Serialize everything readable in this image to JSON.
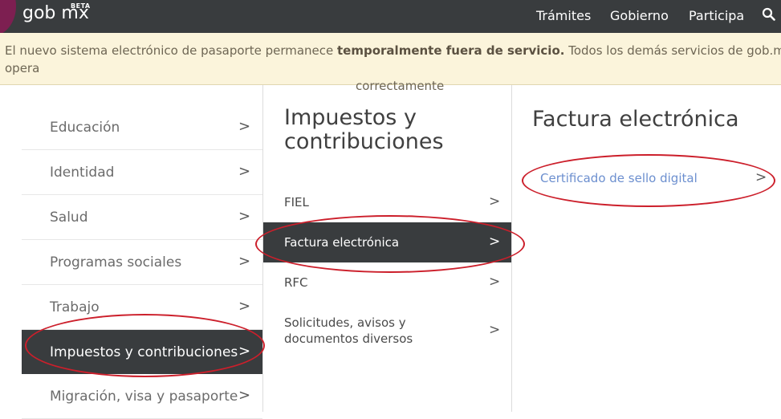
{
  "header": {
    "logo": "gob mx",
    "beta": "BETA",
    "nav": [
      "Trámites",
      "Gobierno",
      "Participa"
    ],
    "search_icon": "search-icon"
  },
  "banner": {
    "text_before": "El nuevo sistema electrónico de pasaporte permanece ",
    "text_bold": "temporalmente fuera de servicio.",
    "text_after": " Todos los demás servicios de gob.mx opera",
    "text_line2": "correctamente"
  },
  "column1": {
    "items": [
      "Educación",
      "Identidad",
      "Salud",
      "Programas sociales",
      "Trabajo",
      "Impuestos y contribuciones",
      "Migración, visa y pasaporte"
    ],
    "active_index": 5,
    "chevron": ">"
  },
  "column2": {
    "title": "Impuestos y contribuciones",
    "items": [
      "FIEL",
      "Factura electrónica",
      "RFC",
      "Solicitudes, avisos y documentos diversos"
    ],
    "active_index": 1,
    "chevron": ">"
  },
  "column3": {
    "title": "Factura electrónica",
    "items": [
      "Certificado de sello digital"
    ],
    "chevron": ">"
  },
  "colors": {
    "header_bg": "#393c3e",
    "banner_bg": "#fbf4db",
    "active_bg": "#393c3e",
    "link": "#6c8fcf",
    "annotation": "#cc1f2b"
  }
}
